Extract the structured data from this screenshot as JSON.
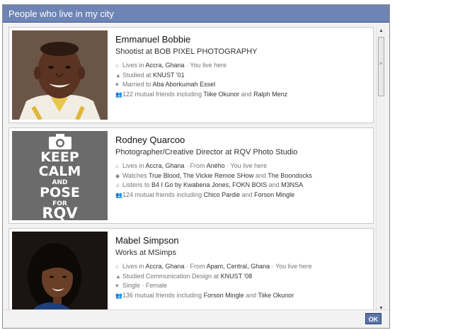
{
  "dialog": {
    "title": "People who live in my city",
    "ok_label": "OK"
  },
  "people": [
    {
      "name": "Emmanuel Bobbie",
      "headline": "Shootist at BOB PIXEL PHOTOGRAPHY",
      "row1_a": "Lives in ",
      "row1_b": "Accra, Ghana",
      "row1_c": " · You live here",
      "row2_a": "Studied at ",
      "row2_b": "KNUST '01",
      "row3_a": "Married to ",
      "row3_b": "Aba Aborkumah Essel",
      "row4_a": "122 mutual friends including ",
      "row4_b": "Tiike Okunor",
      "row4_c": " and ",
      "row4_d": "Ralph Menz"
    },
    {
      "name": "Rodney Quarcoo",
      "headline": "Photographer/Creative Director at RQV Photo Studio",
      "row1_a": "Lives in ",
      "row1_b": "Accra, Ghana",
      "row1_c": " · From ",
      "row1_d": "Aného",
      "row1_e": " · You live here",
      "row2_a": "Watches ",
      "row2_b": "True Blood, The Vickie Remoe SHow",
      "row2_c": " and ",
      "row2_d": "The Boondocks",
      "row3_a": "Listens to ",
      "row3_b": "B4 I Go by Kwabena Jones, FOKN BOIS",
      "row3_c": " and ",
      "row3_d": "M3NSA",
      "row4_a": "124 mutual friends including ",
      "row4_b": "Chico Pardie",
      "row4_c": " and ",
      "row4_d": "Forson Mingle",
      "poster": {
        "l1": "KEEP",
        "l2": "CALM",
        "l3": "AND",
        "l4": "POSE",
        "l5": "FOR",
        "l6": "RQV"
      }
    },
    {
      "name": "Mabel Simpson",
      "headline": "Works at MSimps",
      "row1_a": "Lives in ",
      "row1_b": "Accra, Ghana",
      "row1_c": " · From ",
      "row1_d": "Apam, Central, Ghana",
      "row1_e": " · You live here",
      "row2_a": "Studied Communication Design at ",
      "row2_b": "KNUST '08",
      "row3_a": "Single · Female",
      "row4_a": "136 mutual friends including ",
      "row4_b": "Forson Mingle",
      "row4_c": " and ",
      "row4_d": "Tiike Okunor"
    }
  ],
  "icons": [
    "home-icon",
    "graduation-cap-icon",
    "heart-icon",
    "tag-icon",
    "music-note-icon",
    "friends-icon"
  ]
}
